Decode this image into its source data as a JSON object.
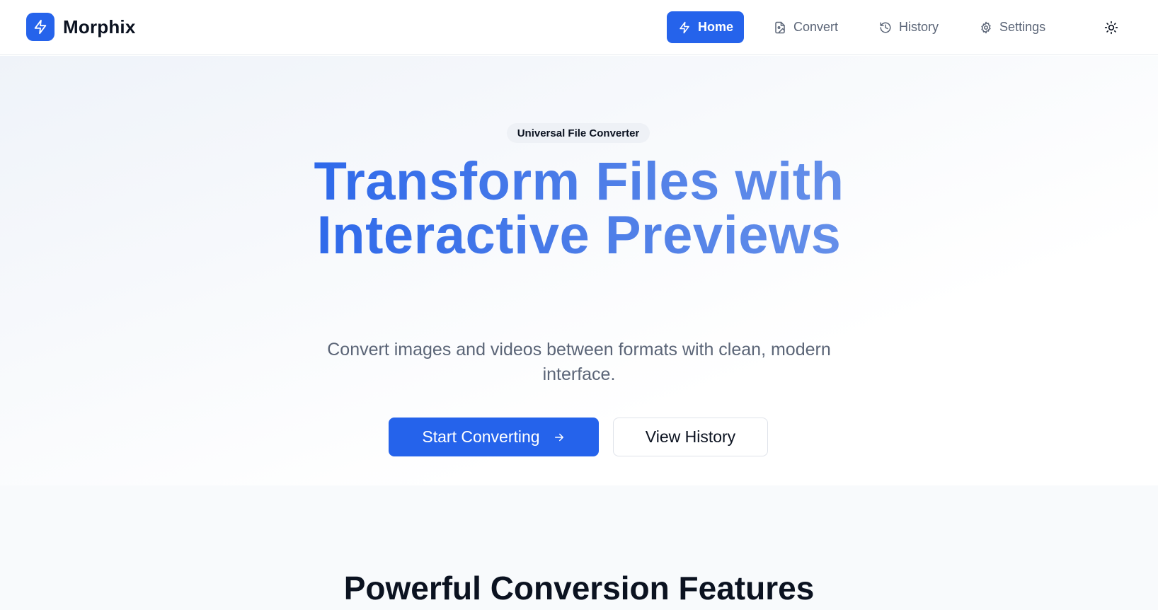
{
  "brand": {
    "name": "Morphix",
    "logo_icon": "lightning-icon",
    "accent_color": "#2563eb"
  },
  "nav": {
    "items": [
      {
        "label": "Home",
        "icon": "lightning-icon",
        "active": true
      },
      {
        "label": "Convert",
        "icon": "file-image-icon",
        "active": false
      },
      {
        "label": "History",
        "icon": "history-icon",
        "active": false
      },
      {
        "label": "Settings",
        "icon": "gear-icon",
        "active": false
      }
    ],
    "theme_toggle_icon": "sun-icon"
  },
  "hero": {
    "badge": "Universal File Converter",
    "title_line1": "Transform Files with",
    "title_line2": "Interactive Previews",
    "subtitle": "Convert images and videos between formats with clean, modern interface.",
    "primary_button": "Start Converting",
    "primary_button_icon": "arrow-right-icon",
    "secondary_button": "View History"
  },
  "features": {
    "title": "Powerful Conversion Features"
  }
}
